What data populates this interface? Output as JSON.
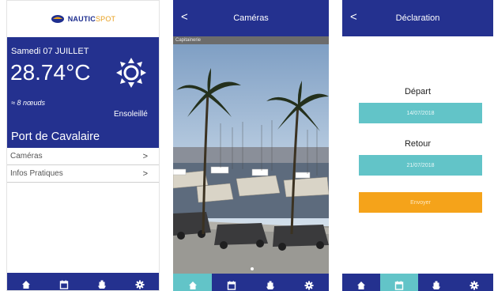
{
  "brand": {
    "logo_main": "NAUTIC",
    "logo_accent": "SPOT"
  },
  "home": {
    "date": "Samedi 07 JUILLET",
    "temperature": "28.74°C",
    "wind": "≈ 8 nœuds",
    "condition": "Ensoleillé",
    "port": "Port de Cavalaire",
    "menu": [
      {
        "label": "Caméras",
        "chevron": ">"
      },
      {
        "label": "Infos Pratiques",
        "chevron": ">"
      }
    ]
  },
  "cameras": {
    "back": "<",
    "title": "Caméras",
    "camera_label": "Capitainerie"
  },
  "declaration": {
    "back": "<",
    "title": "Déclaration",
    "departure_label": "Départ",
    "departure_date": "14/07/2018",
    "return_label": "Retour",
    "return_date": "21/07/2018",
    "send_label": "Envoyer"
  },
  "tabs": [
    "home-icon",
    "calendar-icon",
    "boat-icon",
    "settings-icon"
  ],
  "colors": {
    "navy": "#24318f",
    "teal": "#62c4c8",
    "orange": "#f5a31a"
  }
}
